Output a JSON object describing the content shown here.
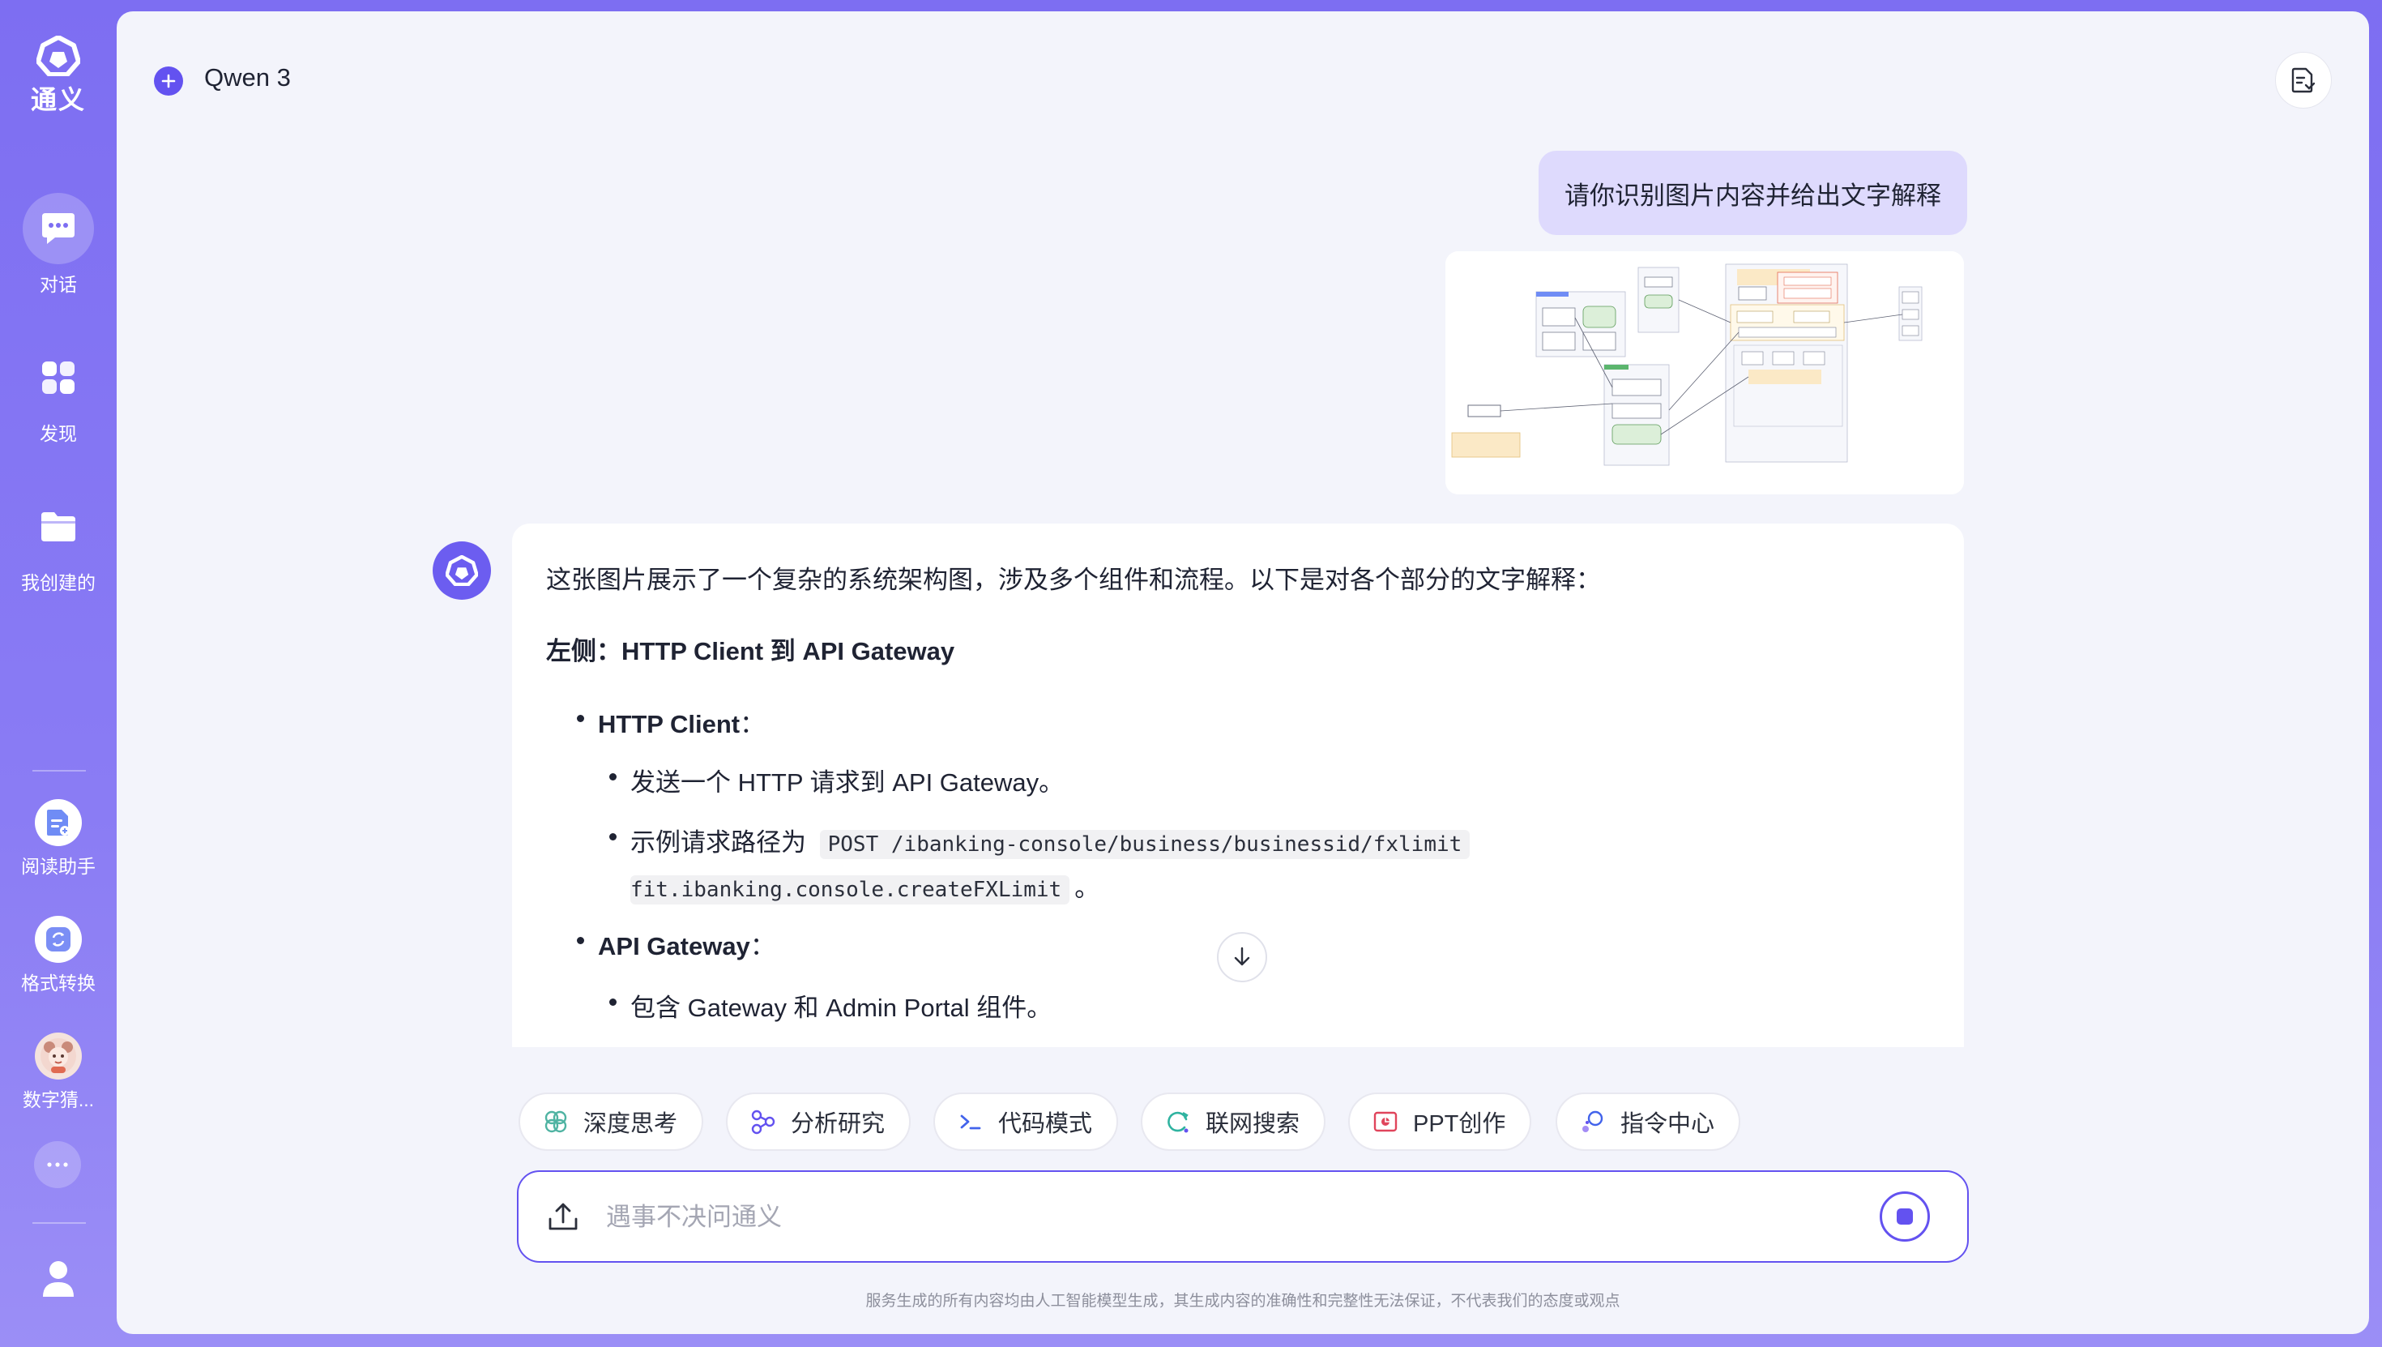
{
  "app": {
    "logo_text": "通义"
  },
  "sidebar": {
    "nav": [
      {
        "label": "对话",
        "icon": "chat-icon"
      },
      {
        "label": "发现",
        "icon": "grid-icon"
      },
      {
        "label": "我创建的",
        "icon": "folder-icon"
      }
    ],
    "tools": [
      {
        "label": "阅读助手",
        "icon": "document-reader-icon"
      },
      {
        "label": "格式转换",
        "icon": "convert-icon"
      },
      {
        "label": "数字猜...",
        "icon": "character-avatar-icon"
      }
    ]
  },
  "header": {
    "model_name": "Qwen 3"
  },
  "conversation": {
    "user_message": "请你识别图片内容并给出文字解释",
    "assistant": {
      "intro": "这张图片展示了一个复杂的系统架构图，涉及多个组件和流程。以下是对各个部分的文字解释：",
      "heading": "左侧：HTTP Client 到 API Gateway",
      "http_client_title": "HTTP Client",
      "http_client_colon": "：",
      "http_client_line1": "发送一个 HTTP 请求到 API Gateway。",
      "http_client_line2_prefix": "示例请求路径为",
      "http_client_code1": "POST /ibanking-console/business/businessid/fxlimit",
      "http_client_code2": "fit.ibanking.console.createFXLimit",
      "http_client_line2_suffix": "。",
      "api_gateway_title": "API Gateway",
      "api_gateway_colon": "：",
      "api_gateway_line1": "包含 Gateway 和 Admin Portal 组件。"
    }
  },
  "chips": [
    {
      "label": "深度思考",
      "icon": "deep-think-icon"
    },
    {
      "label": "分析研究",
      "icon": "analysis-icon"
    },
    {
      "label": "代码模式",
      "icon": "code-icon"
    },
    {
      "label": "联网搜索",
      "icon": "web-search-icon"
    },
    {
      "label": "PPT创作",
      "icon": "ppt-icon"
    },
    {
      "label": "指令中心",
      "icon": "command-center-icon"
    }
  ],
  "input": {
    "placeholder": "遇事不决问通义"
  },
  "disclaimer": "服务生成的所有内容均由人工智能模型生成，其生成内容的准确性和完整性无法保证，不代表我们的态度或观点",
  "colors": {
    "accent": "#6352f0",
    "sidebar": "#7d6ef2",
    "user_bubble": "#dedafd"
  }
}
